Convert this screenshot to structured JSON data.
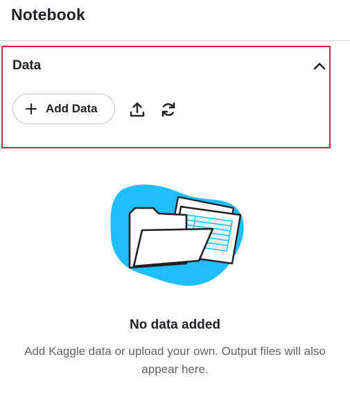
{
  "header": {
    "title": "Notebook"
  },
  "data_section": {
    "title": "Data",
    "add_data_label": "Add Data",
    "icons": {
      "collapse": "chevron-up-icon",
      "add": "plus-icon",
      "upload": "upload-icon",
      "refresh": "refresh-icon"
    }
  },
  "empty_state": {
    "illustration": "folder-with-documents-illustration",
    "title": "No data added",
    "description": "Add Kaggle data or upload your own. Output files will also appear here."
  },
  "colors": {
    "accent_blue": "#20beff",
    "highlight_border": "#d3263b",
    "text_primary": "#202124",
    "text_secondary": "#5f6368"
  }
}
